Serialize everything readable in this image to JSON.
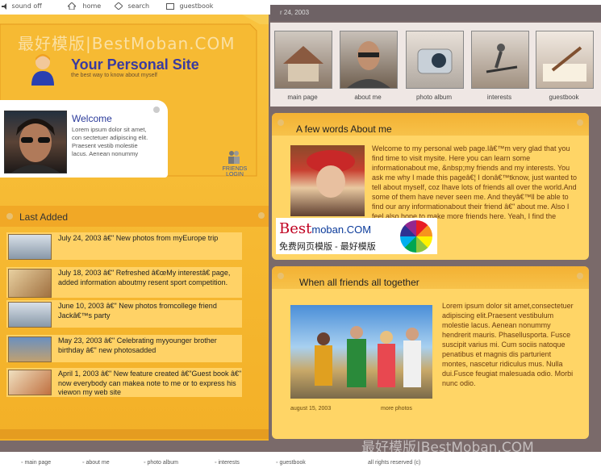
{
  "topnav": {
    "sound": "sound off",
    "home": "home",
    "search": "search",
    "guestbook": "guestbook"
  },
  "date": "r 24, 2003",
  "watermark": "最好模版|BestMoban.COM",
  "site": {
    "title": "Your Personal Site",
    "subtitle": "the best way to know about myself"
  },
  "welcome": {
    "title": "Welcome",
    "text": "Lorem ipsum dolor sit amet, con sectetuer adipiscing elit. Praesent vestib molestie lacus. Aenean nonummy"
  },
  "friends_login": {
    "line1": "FRIENDS",
    "line2": "LOGIN"
  },
  "last_added": {
    "title": "Last Added",
    "items": [
      {
        "text": "July 24, 2003 â€\" New photos from myEurope trip"
      },
      {
        "text": "July 18, 2003 â€\" Refreshed â€œMy interestâ€ page, added information aboutmy resent sport competition."
      },
      {
        "text": "June 10, 2003 â€\" New photos fromcollege friend Jackâ€™s party"
      },
      {
        "text": "May 23, 2003 â€\" Celebrating myyounger brother birthday â€\" new photosadded"
      },
      {
        "text": "April 1, 2003 â€\" New feature created â€\"Guest book â€\" now everybody can makea note to me  or to express his viewon my web site"
      }
    ]
  },
  "thumbs": [
    {
      "label": "main page",
      "icon": "house-icon"
    },
    {
      "label": "about me",
      "icon": "person-icon"
    },
    {
      "label": "photo album",
      "icon": "camera-icon"
    },
    {
      "label": "interests",
      "icon": "skateboard-icon"
    },
    {
      "label": "guestbook",
      "icon": "pen-icon"
    }
  ],
  "about": {
    "title": "A few words About me",
    "text": "Welcome to my personal web page.Iâ€™m very glad that you find time to visit mysite. Here you can learn some informationabout me, &nbsp;my friends and my interests. You ask me why I made this pageâ€¦ I donâ€™tknow, just wanted to tell about myself, coz Ihave lots of friends all over the world.And some of them have never seen me. And theyâ€™ll be able to find our any informationabout their friend â€\" about me. Also I feel also hope to make more friends here. Yeah, I find the significant other."
  },
  "bestmoban": {
    "logo_a": "Best",
    "logo_b": "moban.COM",
    "subtitle": "免费网页模版 - 最好模版"
  },
  "friends": {
    "title": "When all friends all together",
    "text": "Lorem ipsum dolor sit amet,consectetuer adipiscing elit.Praesent vestibulum molestie lacus. Aenean nonummy hendrerit mauris. Phasellusporta. Fusce suscipit varius mi. Cum sociis natoque penatibus et magnis dis parturient montes, nascetur ridiculus mus. Nulla dui.Fusce feugiat malesuada odio. Morbi nunc odio.",
    "date": "august 15, 2003",
    "more": "more photos"
  },
  "bottomnav": {
    "main": "main page",
    "about": "about me",
    "photo": "photo album",
    "interests": "interests",
    "guestbook": "guestbook",
    "rights": "all rights reserved (c)"
  },
  "colors": {
    "accent_orange": "#f3b027",
    "panel_yellow": "#ffd566",
    "frame_grey": "#7a6a6a",
    "title_blue": "#3a3aa0"
  }
}
